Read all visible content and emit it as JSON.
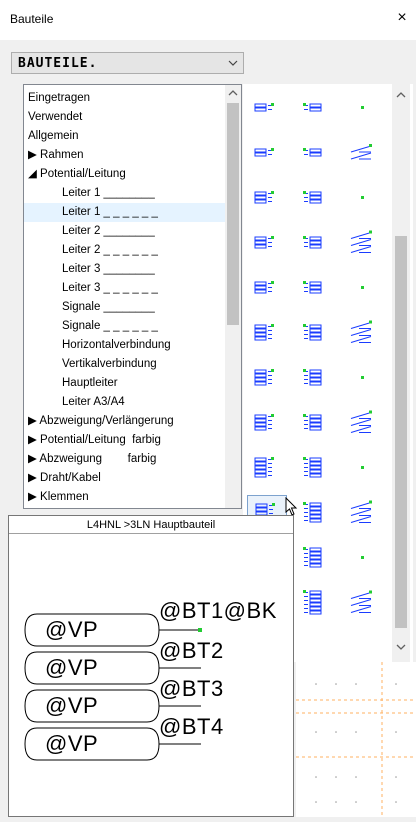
{
  "window": {
    "title": "Bauteile",
    "close_label": "×"
  },
  "combo": {
    "value": "BAUTEILE."
  },
  "tree": {
    "items": [
      {
        "label": "Eingetragen",
        "indent": 0
      },
      {
        "label": "Verwendet",
        "indent": 0
      },
      {
        "label": "Allgemein",
        "indent": 0
      },
      {
        "label": "▶ Rahmen",
        "indent": 0
      },
      {
        "label": "◢ Potential/Leitung",
        "indent": 0
      },
      {
        "label": "Leiter 1 ________",
        "indent": 1
      },
      {
        "label": "Leiter 1 _ _ _ _ _ _",
        "indent": 1
      },
      {
        "label": "Leiter 2 ________",
        "indent": 1
      },
      {
        "label": "Leiter 2 _ _ _ _ _ _",
        "indent": 1
      },
      {
        "label": "Leiter 3 ________",
        "indent": 1
      },
      {
        "label": "Leiter 3 _ _ _ _ _ _",
        "indent": 1
      },
      {
        "label": "Signale ________",
        "indent": 1
      },
      {
        "label": "Signale _ _ _ _ _ _",
        "indent": 1
      },
      {
        "label": "Horizontalverbindung",
        "indent": 1
      },
      {
        "label": "Vertikalverbindung",
        "indent": 1
      },
      {
        "label": "Hauptleiter",
        "indent": 1
      },
      {
        "label": "Leiter A3/A4",
        "indent": 1
      },
      {
        "label": "▶ Abzweigung/Verlängerung",
        "indent": 0
      },
      {
        "label": "▶ Potential/Leitung  farbig",
        "indent": 0
      },
      {
        "label": "▶ Abzweigung        farbig",
        "indent": 0
      },
      {
        "label": "▶ Draht/Kabel",
        "indent": 0
      },
      {
        "label": "▶ Klemmen",
        "indent": 0
      }
    ]
  },
  "popup": {
    "title": "L4HNL >3LN Hauptbauteil",
    "vp_label": "@VP",
    "bt_labels": [
      "@BT1@BK",
      "@BT2",
      "@BT3",
      "@BT4"
    ]
  },
  "colors": {
    "symbol_blue": "#1a3cff",
    "symbol_green": "#22cc33",
    "grid_orange": "#ffb060",
    "selection": "#e5f3ff"
  }
}
